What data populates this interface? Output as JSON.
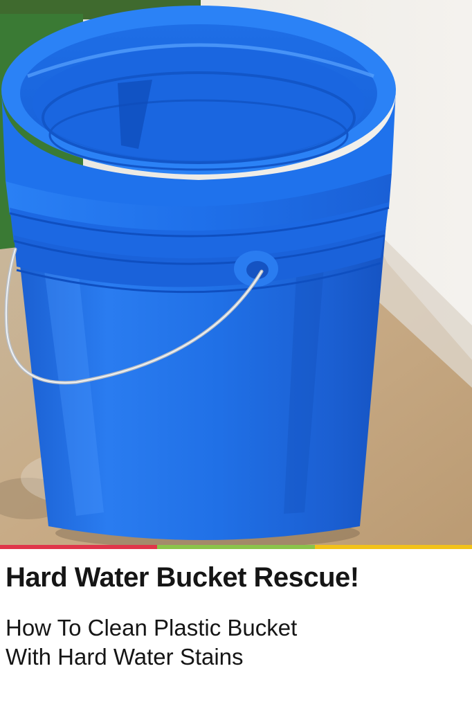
{
  "title": "Hard Water Bucket Rescue!",
  "subtitle_lines": [
    "How To Clean Plastic Bucket",
    "With Hard Water Stains"
  ],
  "colors": {
    "bucket_blue": "#1f6fe0",
    "text": "#151515",
    "stripe": [
      "#e0364a",
      "#8bc34a",
      "#f2c21a"
    ]
  }
}
